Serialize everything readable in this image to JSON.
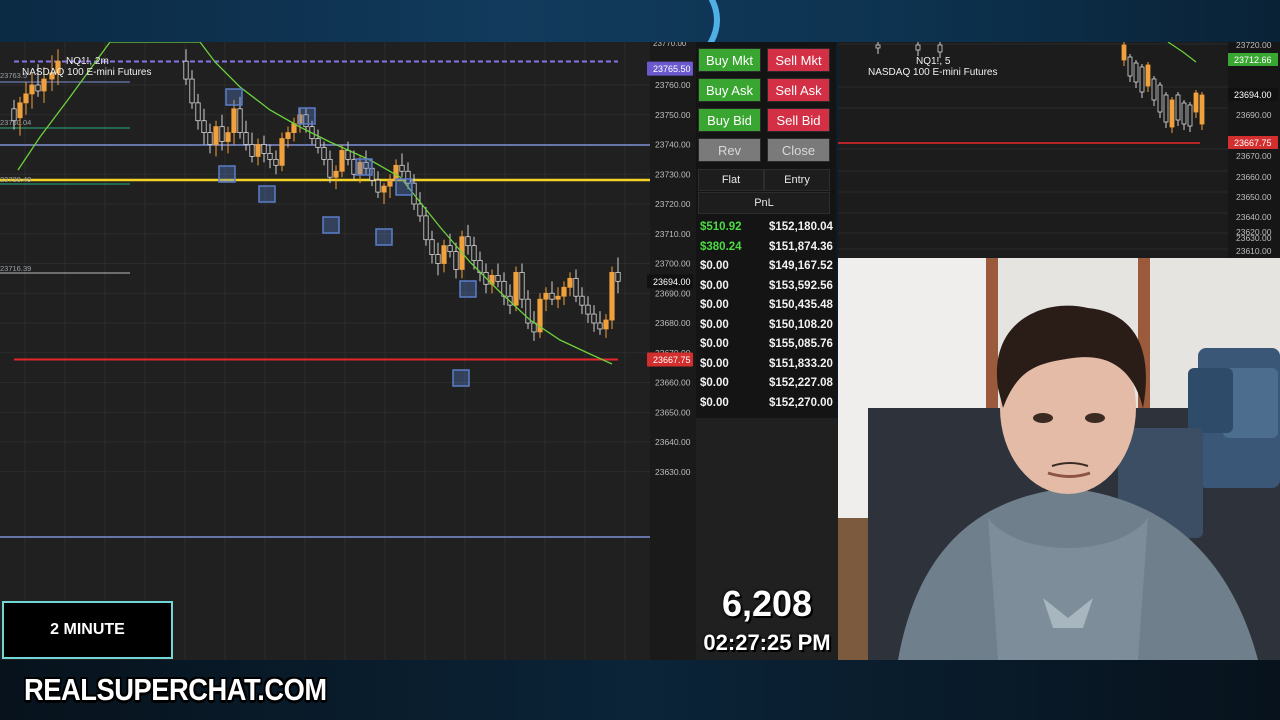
{
  "main_chart": {
    "symbol": "NQ1!, 2m",
    "name": "NASDAQ 100 E-mini Futures",
    "axis_labels": [
      "23760.00",
      "23750.00",
      "23740.00",
      "23730.00",
      "23720.00",
      "23710.00",
      "23700.00",
      "23690.00",
      "23680.00",
      "23670.00",
      "23660.00",
      "23650.00",
      "23640.00",
      "23630.00"
    ],
    "top_axis_label": "23770.00",
    "price_tags": {
      "purple": "23765.50",
      "current": "23694.00",
      "red": "23667.75"
    },
    "level_labels": [
      "23763.5",
      "23750.04",
      "23738.49",
      "23716.39"
    ],
    "colors": {
      "bull": "#f0a13c",
      "bear": "#d8d8d8",
      "ema": "#6cd13c",
      "yellow_level": "#f5d324",
      "red_level": "#e8262b",
      "blue_level": "#7d8fd6",
      "purple_level": "#8a73e6",
      "box": "#5b7fc9"
    }
  },
  "trade_panel": {
    "buttons": {
      "buy_mkt": "Buy Mkt",
      "sell_mkt": "Sell Mkt",
      "buy_ask": "Buy Ask",
      "sell_ask": "Sell Ask",
      "buy_bid": "Buy Bid",
      "sell_bid": "Sell Bid",
      "rev": "Rev",
      "close": "Close"
    },
    "tabs": {
      "flat": "Flat",
      "entry": "Entry",
      "pnl": "PnL"
    },
    "pnl_rows": [
      {
        "pnl": "$510.92",
        "balance": "$152,180.04",
        "positive": true
      },
      {
        "pnl": "$380.24",
        "balance": "$151,874.36",
        "positive": true
      },
      {
        "pnl": "$0.00",
        "balance": "$149,167.52",
        "positive": false
      },
      {
        "pnl": "$0.00",
        "balance": "$153,592.56",
        "positive": false
      },
      {
        "pnl": "$0.00",
        "balance": "$150,435.48",
        "positive": false
      },
      {
        "pnl": "$0.00",
        "balance": "$150,108.20",
        "positive": false
      },
      {
        "pnl": "$0.00",
        "balance": "$155,085.76",
        "positive": false
      },
      {
        "pnl": "$0.00",
        "balance": "$151,833.20",
        "positive": false
      },
      {
        "pnl": "$0.00",
        "balance": "$152,227.08",
        "positive": false
      },
      {
        "pnl": "$0.00",
        "balance": "$152,270.00",
        "positive": false
      }
    ]
  },
  "counter": "6,208",
  "clock": "02:27:25 PM",
  "side_chart": {
    "symbol": "NQ1!, 5",
    "name": "NASDAQ 100 E-mini Futures",
    "axis_labels": [
      "23720.00",
      "23700.00",
      "23690.00",
      "23670.00",
      "23660.00",
      "23650.00",
      "23640.00",
      "23630.00",
      "23620.00",
      "23610.00"
    ],
    "price_tags": {
      "green": "23712.66",
      "current": "23694.00",
      "red": "23667.75"
    }
  },
  "timeframe_label": "2 MINUTE",
  "brand": "REALSUPERCHAT.COM"
}
